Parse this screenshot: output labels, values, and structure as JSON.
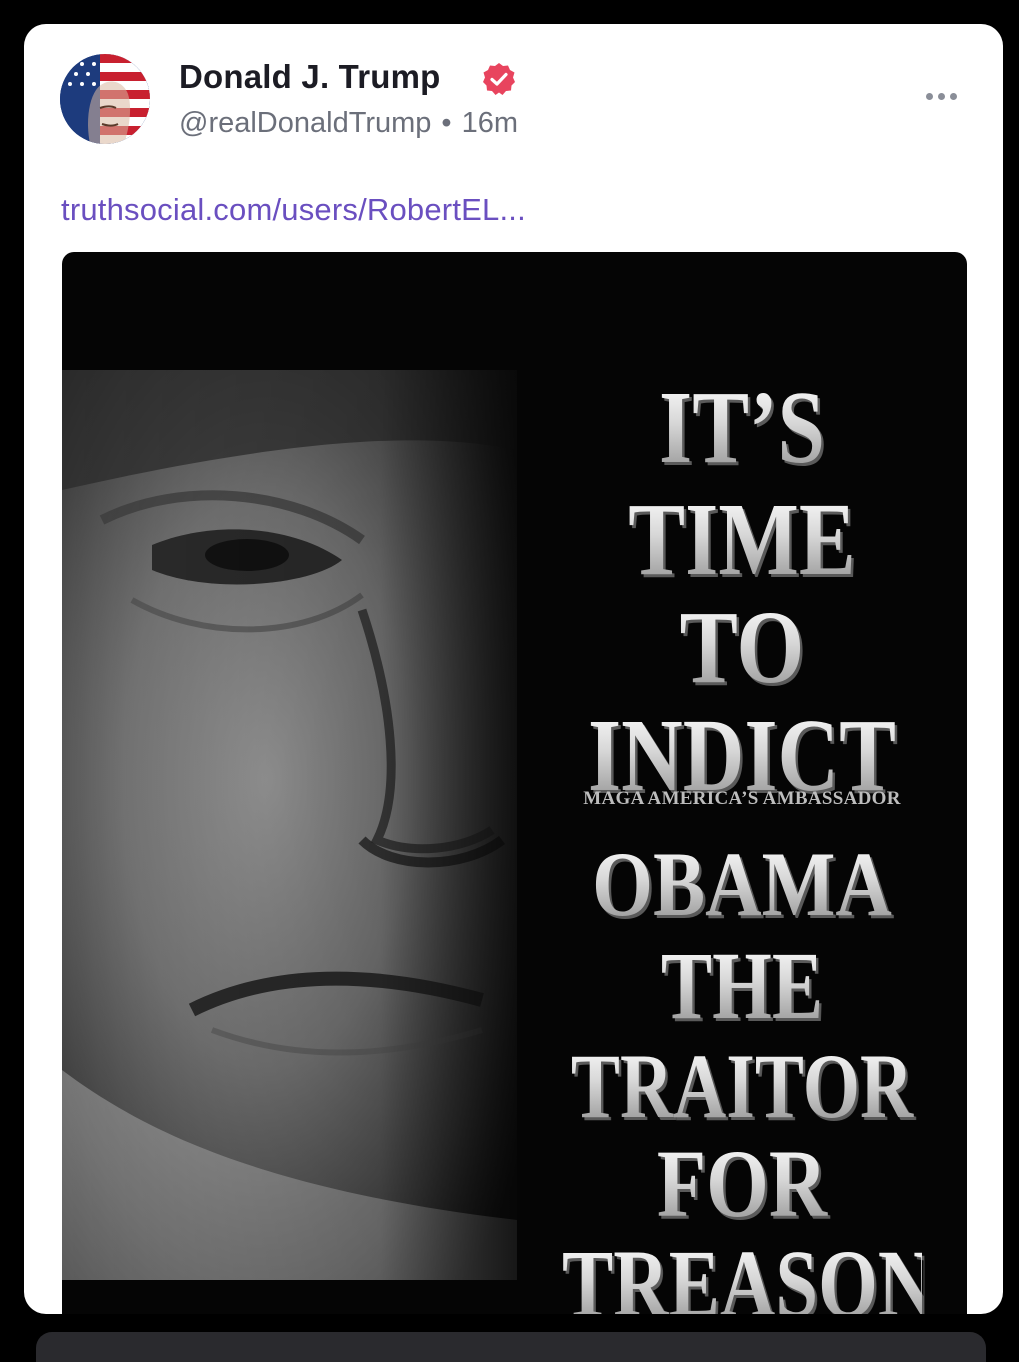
{
  "post": {
    "author": {
      "name": "Donald J. Trump",
      "handle": "@realDonaldTrump",
      "separator": "•",
      "time_ago": "16m",
      "verified_icon": "verified-badge-icon",
      "verified_color": "#e8445e"
    },
    "menu_icon": "more-horizontal-icon",
    "link_text": "truthsocial.com/users/RobertEL...",
    "image": {
      "headline": [
        "IT’S",
        "TIME",
        "TO",
        "INDICT",
        "OBAMA",
        "THE",
        "TRAITOR",
        "FOR",
        "TREASON"
      ],
      "tagline": "MAGA AMERICA’S AMBASSADOR"
    }
  },
  "colors": {
    "link": "#6a4fc0",
    "name": "#1c1c24",
    "meta": "#6b6f7a",
    "card": "#ffffff",
    "frame": "#000000"
  }
}
